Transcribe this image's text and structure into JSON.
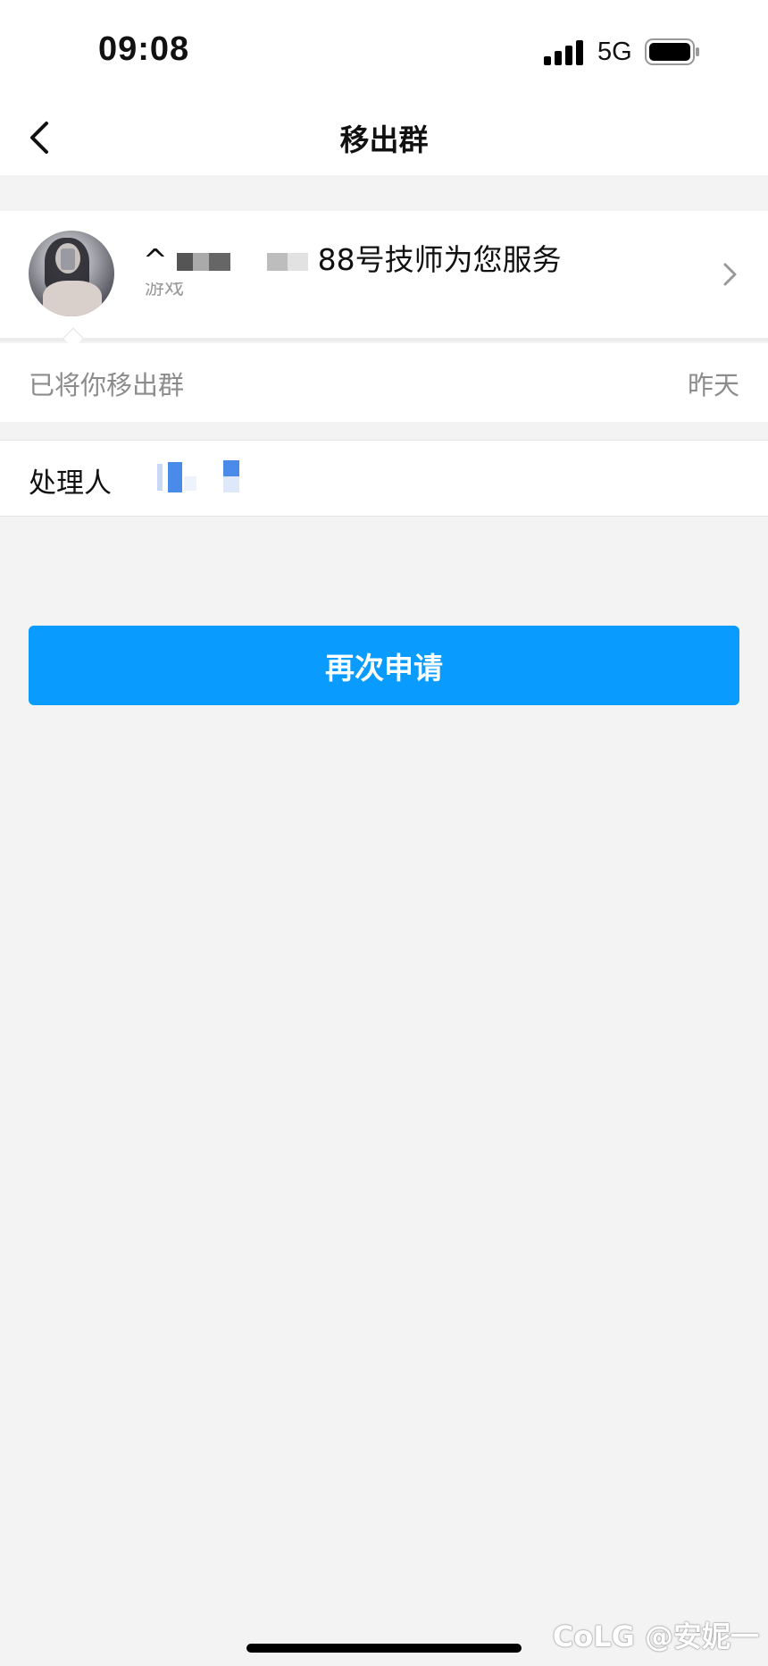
{
  "status_bar": {
    "time": "09:08",
    "network": "5G",
    "icons": [
      "signal-icon",
      "battery-icon"
    ]
  },
  "nav": {
    "title": "移出群",
    "back_icon": "chevron-left-icon"
  },
  "group": {
    "name_prefix": "^",
    "name_suffix": "88号技师为您服务",
    "subtitle": "游戏",
    "chevron_icon": "chevron-right-icon"
  },
  "notice": {
    "text": "已将你移出群",
    "time": "昨天"
  },
  "handler": {
    "label": "处理人"
  },
  "button": {
    "label": "再次申请"
  },
  "watermark": "CoLG @安妮一",
  "colors": {
    "accent": "#0a9bff",
    "background": "#f3f3f3",
    "card": "#ffffff",
    "muted_text": "#8c8c8c"
  }
}
